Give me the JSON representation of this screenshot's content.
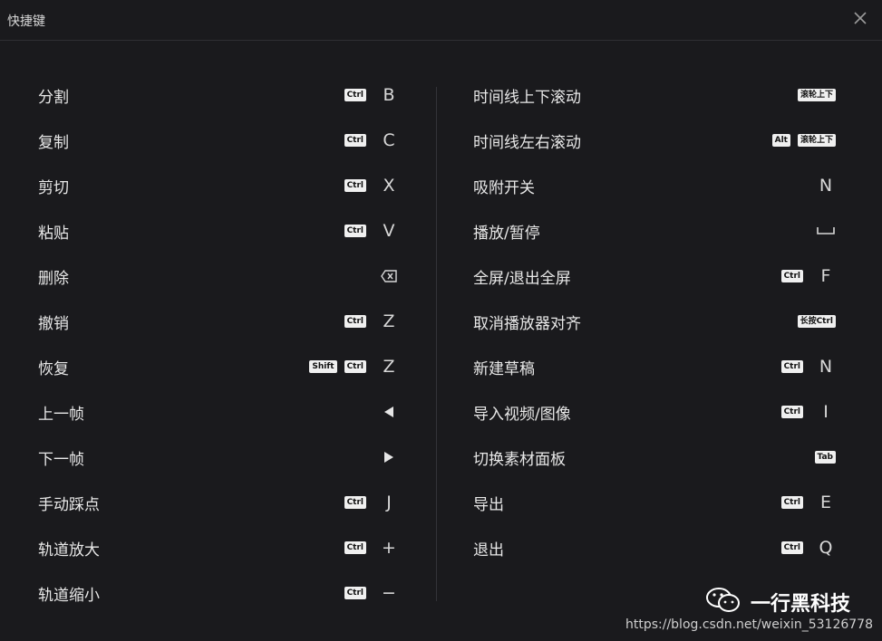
{
  "window": {
    "title": "快捷键",
    "close_icon": "close-icon"
  },
  "left": [
    {
      "label": "分割",
      "badges": [
        "Ctrl"
      ],
      "key": "B"
    },
    {
      "label": "复制",
      "badges": [
        "Ctrl"
      ],
      "key": "C"
    },
    {
      "label": "剪切",
      "badges": [
        "Ctrl"
      ],
      "key": "X"
    },
    {
      "label": "粘贴",
      "badges": [
        "Ctrl"
      ],
      "key": "V"
    },
    {
      "label": "删除",
      "badges": [],
      "key": "",
      "icon": "backspace-icon"
    },
    {
      "label": "撤销",
      "badges": [
        "Ctrl"
      ],
      "key": "Z"
    },
    {
      "label": "恢复",
      "badges": [
        "Shift",
        "Ctrl"
      ],
      "key": "Z"
    },
    {
      "label": "上一帧",
      "badges": [],
      "key": "",
      "icon": "arrow-left-icon"
    },
    {
      "label": "下一帧",
      "badges": [],
      "key": "",
      "icon": "arrow-right-icon"
    },
    {
      "label": "手动踩点",
      "badges": [
        "Ctrl"
      ],
      "key": "J"
    },
    {
      "label": "轨道放大",
      "badges": [
        "Ctrl"
      ],
      "key": "+"
    },
    {
      "label": "轨道缩小",
      "badges": [
        "Ctrl"
      ],
      "key": "−"
    }
  ],
  "right": [
    {
      "label": "时间线上下滚动",
      "badges": [
        "滚轮上下"
      ],
      "key": null
    },
    {
      "label": "时间线左右滚动",
      "badges": [
        "Alt",
        "滚轮上下"
      ],
      "key": null
    },
    {
      "label": "吸附开关",
      "badges": [],
      "key": "N"
    },
    {
      "label": "播放/暂停",
      "badges": [],
      "key": "",
      "icon": "space-icon"
    },
    {
      "label": "全屏/退出全屏",
      "badges": [
        "Ctrl"
      ],
      "key": "F"
    },
    {
      "label": "取消播放器对齐",
      "badges": [
        "长按Ctrl"
      ],
      "key": null
    },
    {
      "label": "新建草稿",
      "badges": [
        "Ctrl"
      ],
      "key": "N"
    },
    {
      "label": "导入视频/图像",
      "badges": [
        "Ctrl"
      ],
      "key": "I"
    },
    {
      "label": "切换素材面板",
      "badges": [
        "Tab"
      ],
      "key": null
    },
    {
      "label": "导出",
      "badges": [
        "Ctrl"
      ],
      "key": "E"
    },
    {
      "label": "退出",
      "badges": [
        "Ctrl"
      ],
      "key": "Q"
    }
  ],
  "watermark": {
    "text": "一行黑科技",
    "icon": "wechat-icon",
    "url": "https://blog.csdn.net/weixin_53126778"
  },
  "colors": {
    "background": "#1a1a1d",
    "text": "#e8e8e8",
    "badge_bg": "#f0f0f0"
  }
}
